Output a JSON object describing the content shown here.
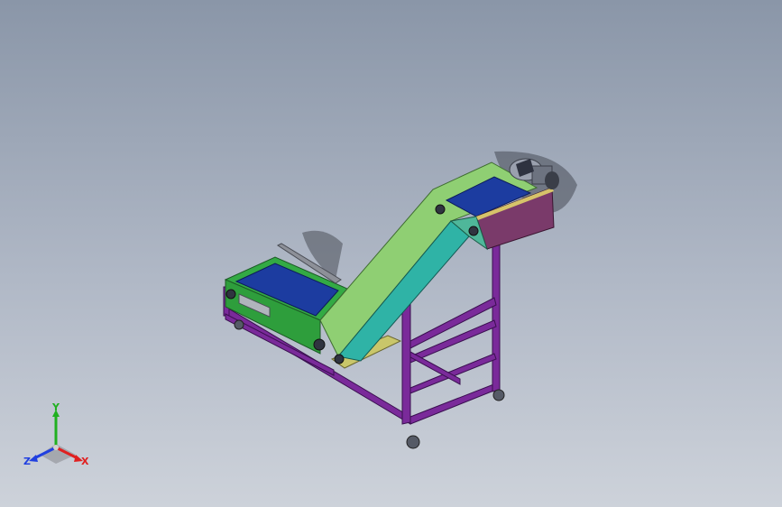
{
  "view": {
    "triad": {
      "x_label": "X",
      "y_label": "Y",
      "z_label": "Z"
    }
  },
  "colors": {
    "background_top": "#8a96a8",
    "background_bottom": "#cdd2da",
    "frame": "#7a2a9a",
    "belt": "#1c3ca0",
    "lower_housing": "#33aa44",
    "incline_housing": "#8fcf73",
    "incline_side": "#2fb3a6",
    "head_box": "#7a3a6a",
    "motor": "#9aa0ae",
    "axis_x": "#e02020",
    "axis_y": "#20b020",
    "axis_z": "#2040e0"
  }
}
